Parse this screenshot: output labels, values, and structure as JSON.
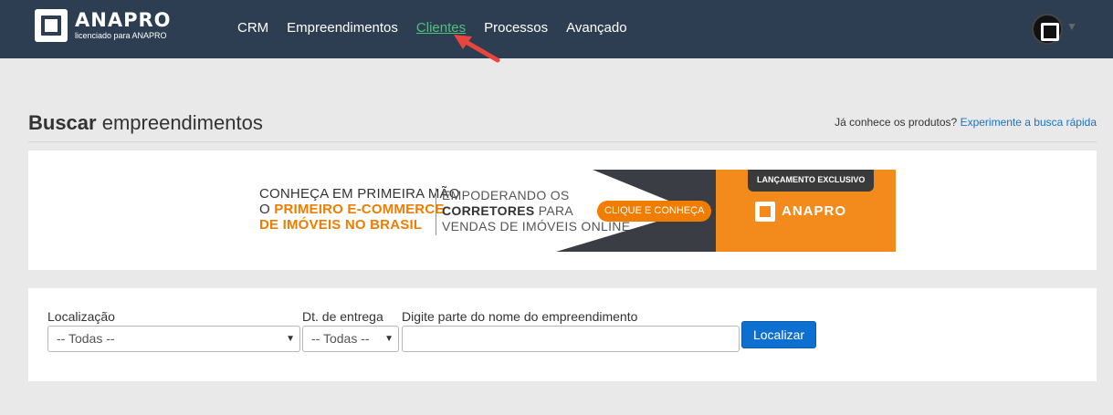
{
  "brand": {
    "name": "ANAPRO",
    "tagline": "licenciado para ANAPRO"
  },
  "nav": {
    "items": [
      {
        "label": "CRM",
        "active": false
      },
      {
        "label": "Empreendimentos",
        "active": false
      },
      {
        "label": "Clientes",
        "active": true
      },
      {
        "label": "Processos",
        "active": false
      },
      {
        "label": "Avançado",
        "active": false
      }
    ]
  },
  "page": {
    "title_bold": "Buscar",
    "title_rest": "empreendimentos",
    "quick_prompt": "Já conhece os produtos?",
    "quick_link": "Experimente a busca rápida"
  },
  "banner": {
    "line1": "CONHEÇA EM PRIMEIRA MÃO",
    "line2_prefix": "O",
    "line2_highlight": "PRIMEIRO E-COMMERCE",
    "line3": "DE IMÓVEIS NO BRASIL",
    "mid1": "EMPODERANDO OS",
    "mid2_bold": "CORRETORES",
    "mid2_rest": "PARA",
    "mid3": "VENDAS DE IMÓVEIS ONLINE",
    "cta": "CLIQUE E CONHEÇA",
    "launch": "LANÇAMENTO EXCLUSIVO",
    "logo": "ANAPRO"
  },
  "search": {
    "location_label": "Localização",
    "location_value": "-- Todas --",
    "delivery_label": "Dt. de entrega",
    "delivery_value": "-- Todas --",
    "name_label": "Digite parte do nome do empreendimento",
    "name_value": "",
    "submit_label": "Localizar"
  },
  "colors": {
    "navbar": "#2d3e52",
    "active_nav": "#4ec27a",
    "link": "#1a73c7",
    "accent_orange": "#f07d00",
    "button": "#0d6fcf"
  }
}
